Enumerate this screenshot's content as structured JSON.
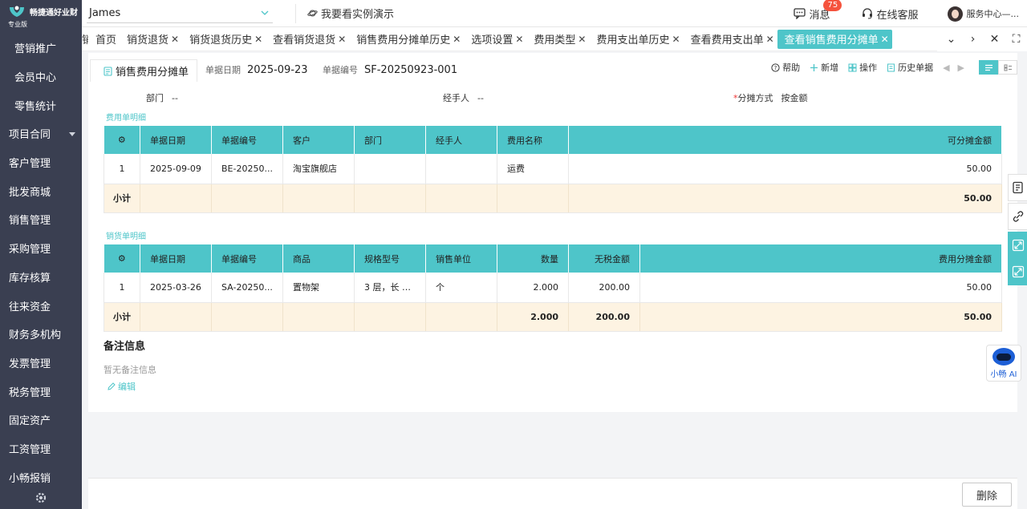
{
  "sidebar": {
    "brand": "畅捷通好业财",
    "edition": "专业版",
    "items": [
      {
        "label": "营销推广",
        "sub": true
      },
      {
        "label": "会员中心",
        "sub": true
      },
      {
        "label": "零售统计",
        "sub": true
      },
      {
        "label": "项目合同",
        "sub": false,
        "caret": true
      },
      {
        "label": "客户管理",
        "sub": false
      },
      {
        "label": "批发商城",
        "sub": false
      },
      {
        "label": "销售管理",
        "sub": false
      },
      {
        "label": "采购管理",
        "sub": false
      },
      {
        "label": "库存核算",
        "sub": false
      },
      {
        "label": "往来资金",
        "sub": false
      },
      {
        "label": "财务多机构",
        "sub": false
      },
      {
        "label": "发票管理",
        "sub": false
      },
      {
        "label": "税务管理",
        "sub": false
      },
      {
        "label": "固定资产",
        "sub": false
      },
      {
        "label": "工资管理",
        "sub": false
      },
      {
        "label": "小畅报销",
        "sub": false
      }
    ]
  },
  "topbar": {
    "user": "James",
    "demo": "我要看实例演示",
    "messages": "消息",
    "message_count": "75",
    "service": "在线客服",
    "account": "服务中心—..."
  },
  "tabs": [
    {
      "label": "首页",
      "close": false,
      "active": false
    },
    {
      "label": "销货退货",
      "close": true,
      "active": false
    },
    {
      "label": "销货退货历史",
      "close": true,
      "active": false
    },
    {
      "label": "查看销货退货",
      "close": true,
      "active": false
    },
    {
      "label": "销售费用分摊单历史",
      "close": true,
      "active": false
    },
    {
      "label": "选项设置",
      "close": true,
      "active": false
    },
    {
      "label": "费用类型",
      "close": true,
      "active": false
    },
    {
      "label": "费用支出单历史",
      "close": true,
      "active": false
    },
    {
      "label": "查看费用支出单",
      "close": true,
      "active": false
    },
    {
      "label": "查看销售费用分摊单",
      "close": true,
      "active": true
    }
  ],
  "bill": {
    "title": "销售费用分摊单",
    "date_label": "单据日期",
    "date": "2025-09-23",
    "no_label": "单据编号",
    "no": "SF-20250923-001",
    "actions": {
      "help": "帮助",
      "add": "新增",
      "ops": "操作",
      "history": "历史单据"
    },
    "dept_label": "部门",
    "dept": "--",
    "handler_label": "经手人",
    "handler": "--",
    "method_label": "分摊方式",
    "method": "按金额"
  },
  "expense_section": {
    "title": "费用单明细",
    "columns": [
      "单据日期",
      "单据编号",
      "客户",
      "部门",
      "经手人",
      "费用名称",
      "可分摊金额"
    ],
    "rows": [
      {
        "idx": "1",
        "date": "2025-09-09",
        "no": "BE-20250...",
        "customer": "淘宝旗舰店",
        "dept": "",
        "handler": "",
        "name": "运费",
        "amount": "50.00"
      }
    ],
    "subtotal_label": "小计",
    "subtotal_amount": "50.00"
  },
  "sales_section": {
    "title": "销货单明细",
    "columns": [
      "单据日期",
      "单据编号",
      "商品",
      "规格型号",
      "销售单位",
      "数量",
      "无税金额",
      "费用分摊金额"
    ],
    "rows": [
      {
        "idx": "1",
        "date": "2025-03-26",
        "no": "SA-20250...",
        "product": "置物架",
        "spec": "3 层，长 6...",
        "unit": "个",
        "qty": "2.000",
        "net": "200.00",
        "alloc": "50.00"
      }
    ],
    "subtotal_label": "小计",
    "subtotal_qty": "2.000",
    "subtotal_net": "200.00",
    "subtotal_alloc": "50.00"
  },
  "remark": {
    "title": "备注信息",
    "empty": "暂无备注信息",
    "edit": "编辑"
  },
  "ai": {
    "label": "小畅 AI"
  },
  "footer": {
    "delete": "删除"
  },
  "colors": {
    "accent": "#4ec5c9",
    "sidebar": "#3a3f51",
    "subtotal_bg": "#fdf3e2",
    "badge": "#f5533d"
  }
}
